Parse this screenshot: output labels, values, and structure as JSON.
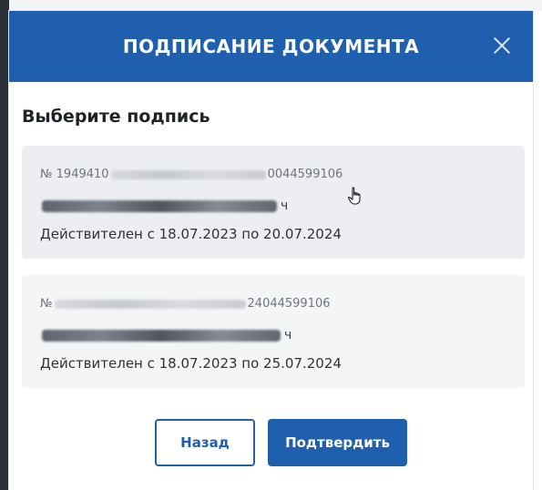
{
  "dialog": {
    "title": "ПОДПИСАНИЕ ДОКУМЕНТА",
    "subtitle": "Выберите подпись"
  },
  "signatures": [
    {
      "number_start": "№ 1949410",
      "number_end": "0044599106",
      "name_end": "ч",
      "validity": "Действителен с 18.07.2023 по 20.07.2024"
    },
    {
      "number_start": "№",
      "number_end": "24044599106",
      "name_end": "ч",
      "validity": "Действителен с 18.07.2023 по 25.07.2024"
    }
  ],
  "buttons": {
    "back": "Назад",
    "confirm": "Подтвердить"
  },
  "colors": {
    "accent": "#1f5fae",
    "header_text": "#ffffff",
    "card_bg": "#eceef1"
  },
  "icons": {
    "close": "close-icon",
    "cursor": "hand-pointer-icon"
  }
}
